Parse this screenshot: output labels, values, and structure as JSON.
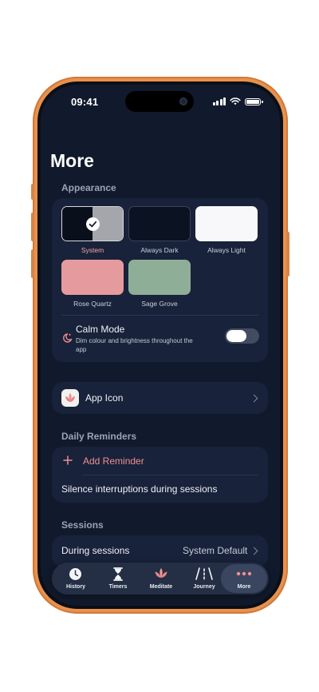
{
  "status_bar": {
    "time": "09:41"
  },
  "page": {
    "title": "More"
  },
  "appearance": {
    "header": "Appearance",
    "themes": [
      {
        "label": "System",
        "selected": true,
        "colors": [
          "#0a0f1c",
          "#a4a6ab"
        ],
        "label_color": "#f2a6a6"
      },
      {
        "label": "Always Dark",
        "selected": false,
        "colors": [
          "#0b1222"
        ]
      },
      {
        "label": "Always Light",
        "selected": false,
        "colors": [
          "#f8f8fb"
        ]
      },
      {
        "label": "Rose Quartz",
        "selected": false,
        "colors": [
          "#e59b9e"
        ]
      },
      {
        "label": "Sage Grove",
        "selected": false,
        "colors": [
          "#8fae98"
        ]
      }
    ],
    "calm_mode": {
      "title": "Calm Mode",
      "subtitle": "Dim colour and brightness throughout the app",
      "icon": "moon-sparkle-icon",
      "enabled": false
    }
  },
  "app_icon": {
    "label": "App Icon",
    "icon": "lotus-icon"
  },
  "daily_reminders": {
    "header": "Daily Reminders",
    "add_label": "Add Reminder",
    "silence_label": "Silence interruptions during sessions"
  },
  "sessions": {
    "header": "Sessions",
    "during_label": "During sessions",
    "during_value": "System Default"
  },
  "tab_bar": {
    "tabs": [
      {
        "label": "History",
        "icon": "clock-icon"
      },
      {
        "label": "Timers",
        "icon": "hourglass-icon"
      },
      {
        "label": "Meditate",
        "icon": "lotus-icon"
      },
      {
        "label": "Journey",
        "icon": "path-icon"
      },
      {
        "label": "More",
        "icon": "ellipsis-icon",
        "active": true
      }
    ]
  },
  "colors": {
    "accent": "#f08f8f",
    "background": "#111a2c",
    "card": "#18223a",
    "frame": "#e8914e"
  }
}
